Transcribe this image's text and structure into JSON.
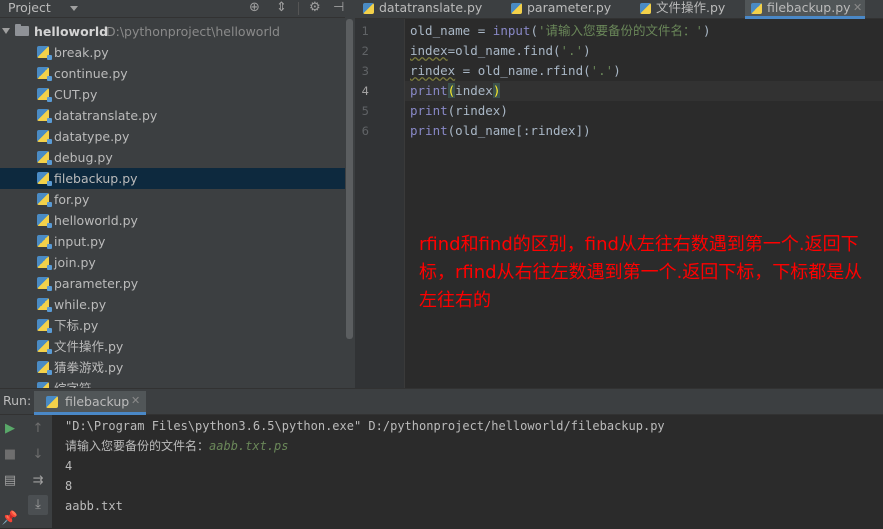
{
  "project_panel": {
    "title": "Project",
    "icons": [
      "target-icon",
      "collapse-icon",
      "gear-icon",
      "hide-icon"
    ],
    "root": {
      "name": "helloworld",
      "path": "D:\\pythonproject\\helloworld"
    },
    "files": [
      "break.py",
      "continue.py",
      "CUT.py",
      "datatranslate.py",
      "datatype.py",
      "debug.py",
      "filebackup.py",
      "for.py",
      "helloworld.py",
      "input.py",
      "join.py",
      "parameter.py",
      "while.py",
      "下标.py",
      "文件操作.py",
      "猜拳游戏.py",
      "综字符"
    ],
    "selected_file": "filebackup.py"
  },
  "editor": {
    "tabs": [
      {
        "label": "datatranslate.py",
        "active": false
      },
      {
        "label": "parameter.py",
        "active": false
      },
      {
        "label": "文件操作.py",
        "active": false
      },
      {
        "label": "filebackup.py",
        "active": true
      }
    ],
    "line_numbers": [
      "1",
      "2",
      "3",
      "4",
      "5",
      "6"
    ],
    "current_line": 4,
    "code": {
      "l1_a": "old_name = ",
      "l1_kw": "input",
      "l1_b": "(",
      "l1_str": "'请输入您要备份的文件名：'",
      "l1_c": ")",
      "l2_a": "index",
      "l2_b": "=old_name.find(",
      "l2_str": "'.'",
      "l2_c": ")",
      "l3_a": "rindex",
      "l3_b": " = old_name.rfind(",
      "l3_str": "'.'",
      "l3_c": ")",
      "l4_kw": "print",
      "l4_open": "(",
      "l4_arg": "index",
      "l4_close": ")",
      "l5_kw": "print",
      "l5_rest": "(rindex)",
      "l6_kw": "print",
      "l6_rest": "(old_name[:rindex])"
    },
    "annotation": "rfind和find的区别，find从左往右数遇到第一个.返回下标，rfind从右往左数遇到第一个.返回下标，下标都是从左往右的"
  },
  "run_panel": {
    "label": "Run:",
    "tab_label": "filebackup",
    "output": {
      "command": "\"D:\\Program Files\\python3.6.5\\python.exe\" D:/pythonproject/helloworld/filebackup.py",
      "prompt": "请输入您要备份的文件名：",
      "user_input": "aabb.txt.ps",
      "line3": "4",
      "line4": "8",
      "line5": "aabb.txt"
    }
  },
  "colors": {
    "keyword": "#8888c6",
    "string": "#6a8759",
    "annotation": "#ff0000",
    "selection": "#0d293e",
    "tab_underline": "#4a88c7"
  }
}
